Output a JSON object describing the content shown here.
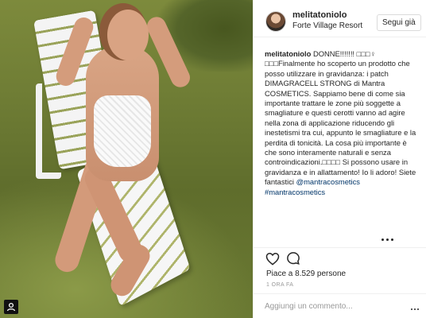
{
  "post": {
    "username": "melitatoniolo",
    "location": "Forte Village Resort",
    "follow_label": "Segui già",
    "caption_user": "melitatoniolo",
    "caption_text_1": " DONNE!!!!!!! □□□♀ □□□Finalmente ho scoperto un prodotto che posso utilizzare in gravidanza: i patch DIMAGRACELL STRONG di Mantra COSMETICS. Sappiamo bene di come sia importante trattare le zone più soggette a smagliature e questi cerotti vanno ad agire nella zona di applicazione riducendo gli inestetismi tra cui, appunto le smagliature e la perdita di tonicità. La cosa più importante è che sono interamente naturali e senza controindicazioni.□□□□ Si possono usare in gravidanza e in allattamento! Io li adoro! Siete fantastici ",
    "mention": "@mantracosmetics",
    "hashtag": "#mantracosmetics",
    "likes": "Piace a 8.529 persone",
    "time": "1 ORA FA",
    "comment_placeholder": "Aggiungi un commento..."
  },
  "icons": {
    "heart": "heart-icon",
    "comment": "comment-icon",
    "more": "more-options-icon",
    "photo_tag": "instagram-tag-icon"
  },
  "colors": {
    "link": "#003569",
    "text": "#262626",
    "muted": "#999999",
    "border": "#efefef"
  }
}
